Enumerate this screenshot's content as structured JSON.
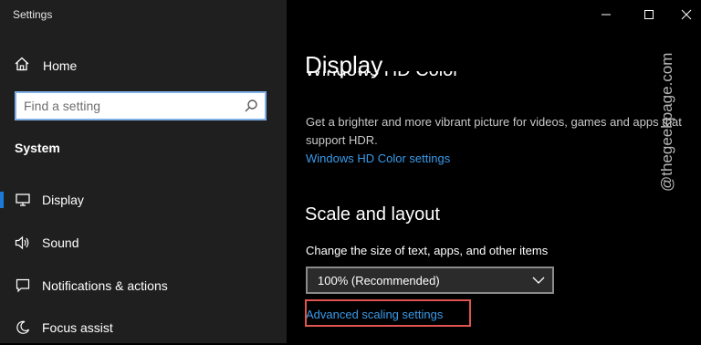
{
  "window": {
    "title": "Settings"
  },
  "sidebar": {
    "home_label": "Home",
    "search_placeholder": "Find a setting",
    "section": "System",
    "items": [
      {
        "label": "Display",
        "icon": "monitor-icon",
        "active": true
      },
      {
        "label": "Sound",
        "icon": "speaker-icon",
        "active": false
      },
      {
        "label": "Notifications & actions",
        "icon": "notification-icon",
        "active": false
      },
      {
        "label": "Focus assist",
        "icon": "moon-icon",
        "active": false
      }
    ]
  },
  "main": {
    "title": "Display",
    "cut_heading": "Windows HD Color",
    "hd_description": "Get a brighter and more vibrant picture for videos, games and apps that support HDR.",
    "hd_link": "Windows HD Color settings",
    "scale_heading": "Scale and layout",
    "scale_label": "Change the size of text, apps, and other items",
    "scale_value": "100% (Recommended)",
    "advanced_link": "Advanced scaling settings"
  },
  "watermark": "@thegeekpage.com",
  "colors": {
    "accent": "#1e7ad9",
    "link": "#3a9bea",
    "highlight": "#e0544f",
    "sidebar_bg": "#1f1f1f",
    "main_bg": "#000000"
  }
}
